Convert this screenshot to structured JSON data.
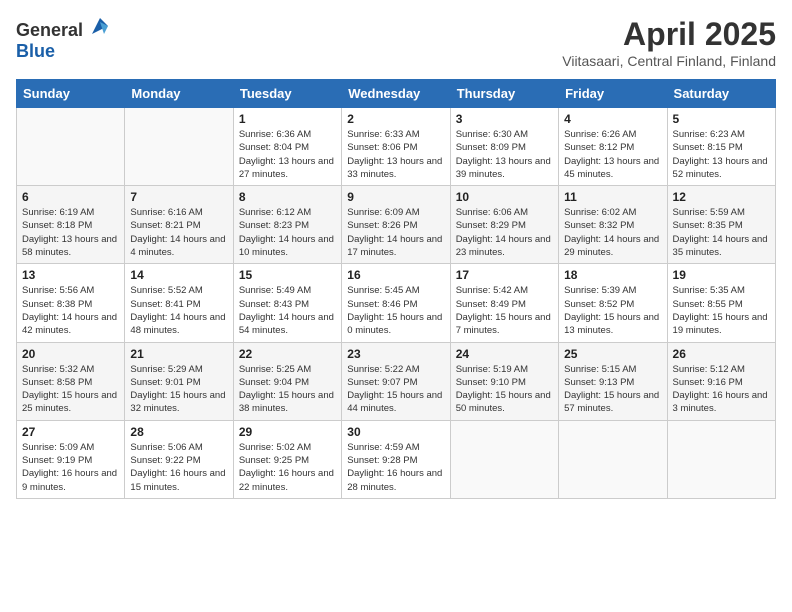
{
  "header": {
    "logo_general": "General",
    "logo_blue": "Blue",
    "month_title": "April 2025",
    "location": "Viitasaari, Central Finland, Finland"
  },
  "days_of_week": [
    "Sunday",
    "Monday",
    "Tuesday",
    "Wednesday",
    "Thursday",
    "Friday",
    "Saturday"
  ],
  "weeks": [
    [
      {
        "day": "",
        "info": ""
      },
      {
        "day": "",
        "info": ""
      },
      {
        "day": "1",
        "info": "Sunrise: 6:36 AM\nSunset: 8:04 PM\nDaylight: 13 hours and 27 minutes."
      },
      {
        "day": "2",
        "info": "Sunrise: 6:33 AM\nSunset: 8:06 PM\nDaylight: 13 hours and 33 minutes."
      },
      {
        "day": "3",
        "info": "Sunrise: 6:30 AM\nSunset: 8:09 PM\nDaylight: 13 hours and 39 minutes."
      },
      {
        "day": "4",
        "info": "Sunrise: 6:26 AM\nSunset: 8:12 PM\nDaylight: 13 hours and 45 minutes."
      },
      {
        "day": "5",
        "info": "Sunrise: 6:23 AM\nSunset: 8:15 PM\nDaylight: 13 hours and 52 minutes."
      }
    ],
    [
      {
        "day": "6",
        "info": "Sunrise: 6:19 AM\nSunset: 8:18 PM\nDaylight: 13 hours and 58 minutes."
      },
      {
        "day": "7",
        "info": "Sunrise: 6:16 AM\nSunset: 8:21 PM\nDaylight: 14 hours and 4 minutes."
      },
      {
        "day": "8",
        "info": "Sunrise: 6:12 AM\nSunset: 8:23 PM\nDaylight: 14 hours and 10 minutes."
      },
      {
        "day": "9",
        "info": "Sunrise: 6:09 AM\nSunset: 8:26 PM\nDaylight: 14 hours and 17 minutes."
      },
      {
        "day": "10",
        "info": "Sunrise: 6:06 AM\nSunset: 8:29 PM\nDaylight: 14 hours and 23 minutes."
      },
      {
        "day": "11",
        "info": "Sunrise: 6:02 AM\nSunset: 8:32 PM\nDaylight: 14 hours and 29 minutes."
      },
      {
        "day": "12",
        "info": "Sunrise: 5:59 AM\nSunset: 8:35 PM\nDaylight: 14 hours and 35 minutes."
      }
    ],
    [
      {
        "day": "13",
        "info": "Sunrise: 5:56 AM\nSunset: 8:38 PM\nDaylight: 14 hours and 42 minutes."
      },
      {
        "day": "14",
        "info": "Sunrise: 5:52 AM\nSunset: 8:41 PM\nDaylight: 14 hours and 48 minutes."
      },
      {
        "day": "15",
        "info": "Sunrise: 5:49 AM\nSunset: 8:43 PM\nDaylight: 14 hours and 54 minutes."
      },
      {
        "day": "16",
        "info": "Sunrise: 5:45 AM\nSunset: 8:46 PM\nDaylight: 15 hours and 0 minutes."
      },
      {
        "day": "17",
        "info": "Sunrise: 5:42 AM\nSunset: 8:49 PM\nDaylight: 15 hours and 7 minutes."
      },
      {
        "day": "18",
        "info": "Sunrise: 5:39 AM\nSunset: 8:52 PM\nDaylight: 15 hours and 13 minutes."
      },
      {
        "day": "19",
        "info": "Sunrise: 5:35 AM\nSunset: 8:55 PM\nDaylight: 15 hours and 19 minutes."
      }
    ],
    [
      {
        "day": "20",
        "info": "Sunrise: 5:32 AM\nSunset: 8:58 PM\nDaylight: 15 hours and 25 minutes."
      },
      {
        "day": "21",
        "info": "Sunrise: 5:29 AM\nSunset: 9:01 PM\nDaylight: 15 hours and 32 minutes."
      },
      {
        "day": "22",
        "info": "Sunrise: 5:25 AM\nSunset: 9:04 PM\nDaylight: 15 hours and 38 minutes."
      },
      {
        "day": "23",
        "info": "Sunrise: 5:22 AM\nSunset: 9:07 PM\nDaylight: 15 hours and 44 minutes."
      },
      {
        "day": "24",
        "info": "Sunrise: 5:19 AM\nSunset: 9:10 PM\nDaylight: 15 hours and 50 minutes."
      },
      {
        "day": "25",
        "info": "Sunrise: 5:15 AM\nSunset: 9:13 PM\nDaylight: 15 hours and 57 minutes."
      },
      {
        "day": "26",
        "info": "Sunrise: 5:12 AM\nSunset: 9:16 PM\nDaylight: 16 hours and 3 minutes."
      }
    ],
    [
      {
        "day": "27",
        "info": "Sunrise: 5:09 AM\nSunset: 9:19 PM\nDaylight: 16 hours and 9 minutes."
      },
      {
        "day": "28",
        "info": "Sunrise: 5:06 AM\nSunset: 9:22 PM\nDaylight: 16 hours and 15 minutes."
      },
      {
        "day": "29",
        "info": "Sunrise: 5:02 AM\nSunset: 9:25 PM\nDaylight: 16 hours and 22 minutes."
      },
      {
        "day": "30",
        "info": "Sunrise: 4:59 AM\nSunset: 9:28 PM\nDaylight: 16 hours and 28 minutes."
      },
      {
        "day": "",
        "info": ""
      },
      {
        "day": "",
        "info": ""
      },
      {
        "day": "",
        "info": ""
      }
    ]
  ]
}
